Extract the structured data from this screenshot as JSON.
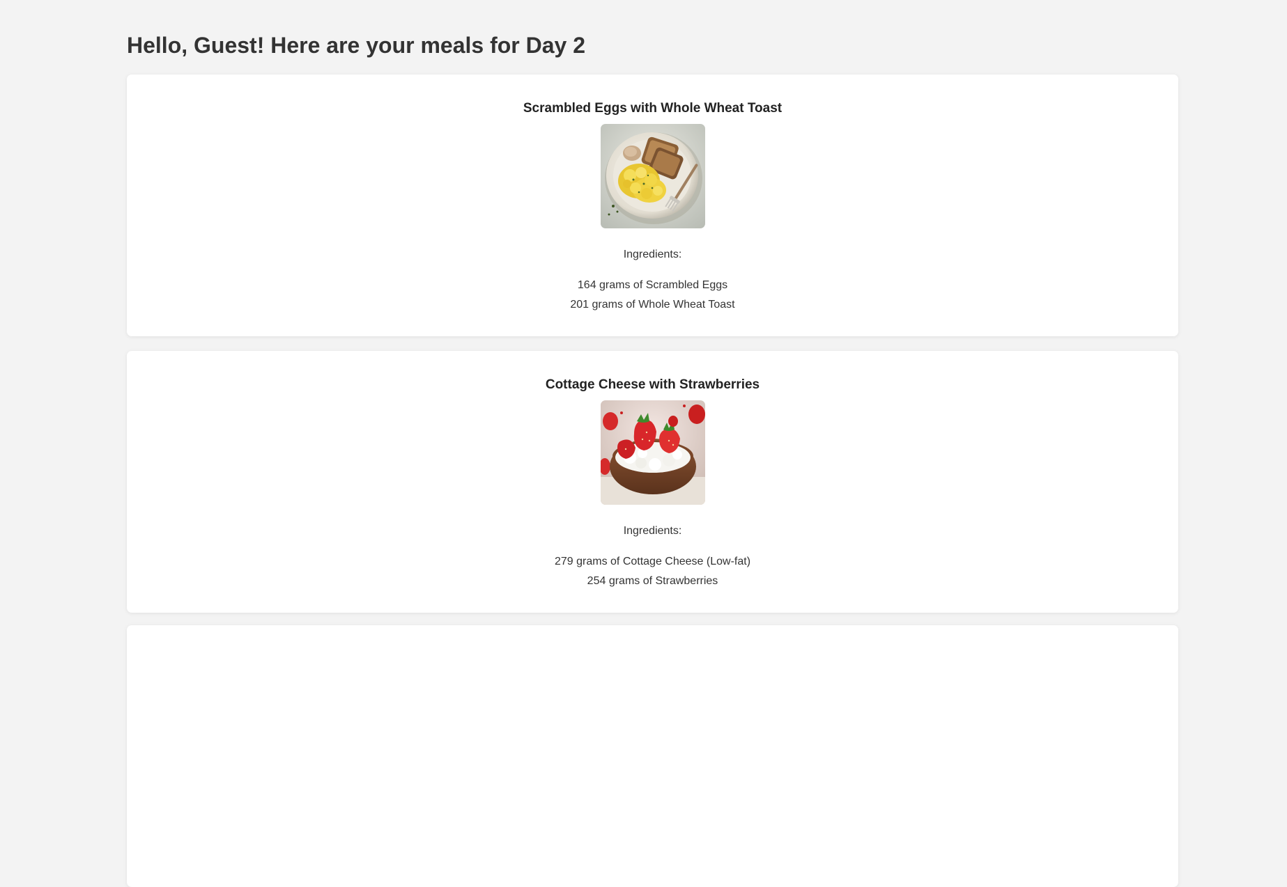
{
  "greeting": "Hello, Guest! Here are your meals for Day 2",
  "meals": [
    {
      "name": "Scrambled Eggs with Whole Wheat Toast",
      "image_icon": "scrambled-eggs-toast-photo",
      "ingredients_label": "Ingredients:",
      "ingredients": [
        "164 grams of Scrambled Eggs",
        "201 grams of Whole Wheat Toast"
      ]
    },
    {
      "name": "Cottage Cheese with Strawberries",
      "image_icon": "cottage-cheese-strawberries-photo",
      "ingredients_label": "Ingredients:",
      "ingredients": [
        "279 grams of Cottage Cheese (Low-fat)",
        "254 grams of Strawberries"
      ]
    }
  ]
}
